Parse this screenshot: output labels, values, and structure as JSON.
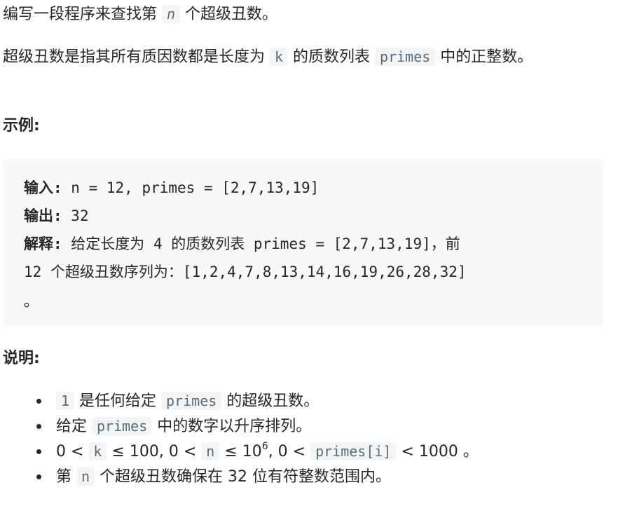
{
  "intro": {
    "prefix": "编写一段程序来查找第 ",
    "var_n": "n",
    "suffix": " 个超级丑数。"
  },
  "definition": {
    "part1": "超级丑数是指其所有质因数都是长度为 ",
    "var_k": "k",
    "part2": " 的质数列表 ",
    "var_primes": "primes",
    "part3": " 中的正整数。"
  },
  "example": {
    "heading": "示例:",
    "input_label": "输入:",
    "input_value": " n = 12, primes = [2,7,13,19]",
    "output_label": "输出:",
    "output_value": " 32 ",
    "explain_label": "解释:",
    "explain_line1": " 给定长度为 4 的质数列表 primes = [2,7,13,19]，前",
    "explain_line2": "12 个超级丑数序列为：[1,2,4,7,8,13,14,16,19,26,28,32]",
    "explain_tail": "。"
  },
  "notes": {
    "heading": "说明:",
    "items": [
      {
        "code1": "1",
        "text1": " 是任何给定 ",
        "code2": "primes",
        "text2": " 的超级丑数。"
      },
      {
        "text0": " 给定 ",
        "code1": "primes",
        "text1": " 中的数字以升序排列。"
      },
      {
        "t0": "0 < ",
        "c_k": "k",
        "t1": " ≤ 100, 0 < ",
        "c_n": "n",
        "t2": " ≤ 10",
        "sup": "6",
        "t3": ", 0 < ",
        "c_p": "primes[i]",
        "t4": " < 1000 。"
      },
      {
        "text0": "第 ",
        "code1": "n",
        "text1": " 个超级丑数确保在 32 位有符整数范围内。"
      }
    ]
  }
}
